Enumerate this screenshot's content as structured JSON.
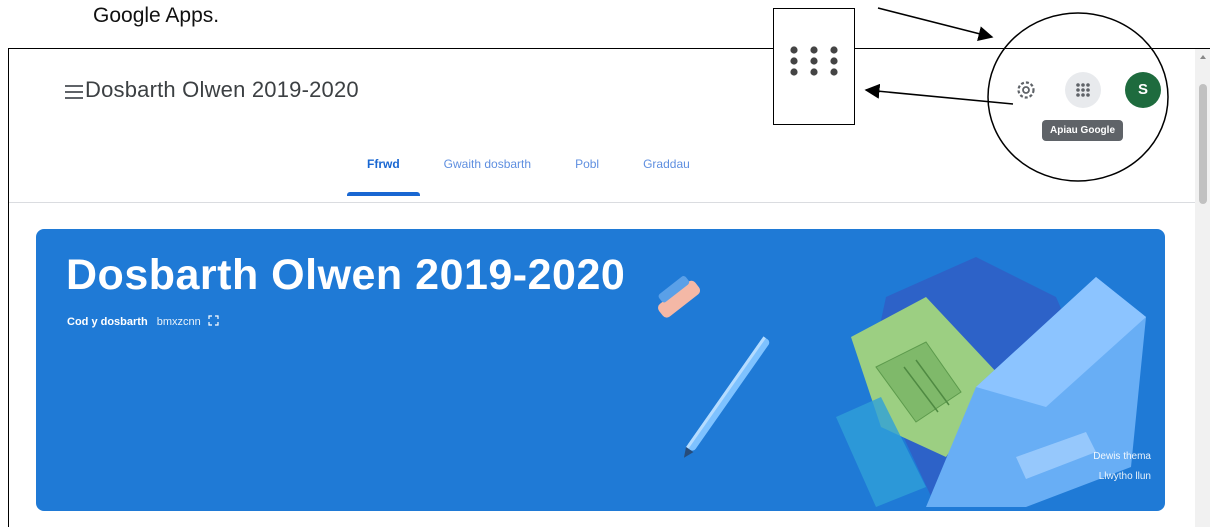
{
  "caption": "Google Apps.",
  "header": {
    "class_title": "Dosbarth Olwen 2019-2020",
    "tabs": [
      {
        "label": "Ffrwd",
        "active": true
      },
      {
        "label": "Gwaith dosbarth",
        "active": false
      },
      {
        "label": "Pobl",
        "active": false
      },
      {
        "label": "Graddau",
        "active": false
      }
    ],
    "avatar_initial": "S",
    "apps_tooltip": "Apiau Google"
  },
  "banner": {
    "title": "Dosbarth Olwen 2019-2020",
    "class_code_label": "Cod y dosbarth",
    "class_code_value": "bmxzcnn",
    "select_theme": "Dewis thema",
    "upload_photo": "Llwytho llun",
    "color": "#1f7ad6"
  },
  "colors": {
    "accent": "#1967d2",
    "avatar": "#1e6b3e"
  },
  "icons": [
    "menu-icon",
    "gear-icon",
    "apps-grid-icon",
    "expand-icon"
  ]
}
